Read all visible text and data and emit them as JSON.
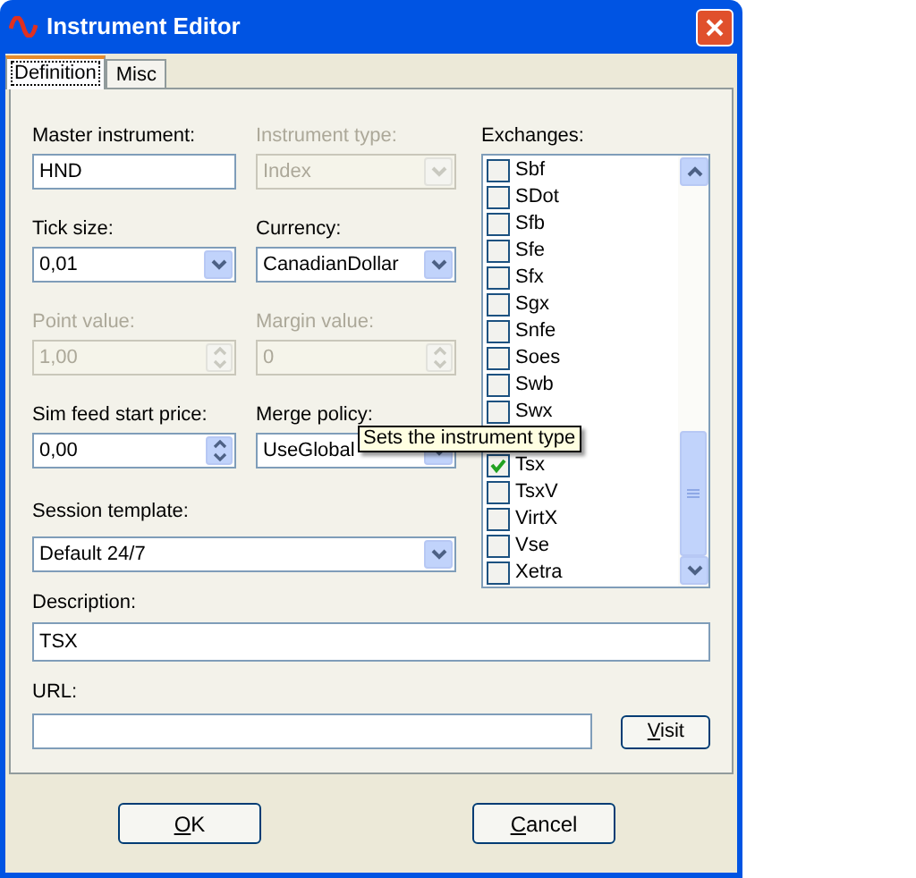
{
  "window": {
    "title": "Instrument Editor"
  },
  "tabs": [
    {
      "label": "Definition",
      "selected": true
    },
    {
      "label": "Misc",
      "selected": false
    }
  ],
  "fields": [
    {
      "label": "Master instrument:",
      "kind": "text",
      "value": "HND",
      "disabled": false
    },
    {
      "label": "Instrument type:",
      "kind": "combo",
      "value": "Index",
      "disabled": true
    },
    {
      "label": "Tick size:",
      "kind": "combo",
      "value": "0,01",
      "disabled": false
    },
    {
      "label": "Currency:",
      "kind": "combo",
      "value": "CanadianDollar",
      "disabled": false
    },
    {
      "label": "Point value:",
      "kind": "spin",
      "value": "1,00",
      "disabled": true
    },
    {
      "label": "Margin value:",
      "kind": "spin",
      "value": "0",
      "disabled": true
    },
    {
      "label": "Sim feed start price:",
      "kind": "spin",
      "value": "0,00",
      "disabled": false
    },
    {
      "label": "Merge policy:",
      "kind": "combo",
      "value": "UseGlobal",
      "disabled": false
    }
  ],
  "session_template": {
    "label": "Session template:",
    "value": "Default 24/7"
  },
  "description": {
    "label": "Description:",
    "value": "TSX"
  },
  "url": {
    "label": "URL:",
    "button": "Visit"
  },
  "exchanges": {
    "label": "Exchanges:",
    "items": [
      {
        "kind": "exchange",
        "name": "Sbf",
        "checked": false
      },
      {
        "kind": "exchange",
        "name": "SDot",
        "checked": false
      },
      {
        "kind": "exchange",
        "name": "Sfb",
        "checked": false
      },
      {
        "kind": "exchange",
        "name": "Sfe",
        "checked": false
      },
      {
        "kind": "exchange",
        "name": "Sfx",
        "checked": false
      },
      {
        "kind": "exchange",
        "name": "Sgx",
        "checked": false
      },
      {
        "kind": "exchange",
        "name": "Snfe",
        "checked": false
      },
      {
        "kind": "exchange",
        "name": "Soes",
        "checked": false
      },
      {
        "kind": "exchange",
        "name": "Swb",
        "checked": false
      },
      {
        "kind": "exchange",
        "name": "Swx",
        "checked": false
      },
      {
        "kind": "covered"
      },
      {
        "kind": "exchange",
        "name": "Tsx",
        "checked": true
      },
      {
        "kind": "exchange",
        "name": "TsxV",
        "checked": false
      },
      {
        "kind": "exchange",
        "name": "VirtX",
        "checked": false
      },
      {
        "kind": "exchange",
        "name": "Vse",
        "checked": false
      },
      {
        "kind": "exchange",
        "name": "Xetra",
        "checked": false
      }
    ]
  },
  "tooltip": "Sets the instrument type",
  "buttons": [
    "OK",
    "Cancel"
  ]
}
